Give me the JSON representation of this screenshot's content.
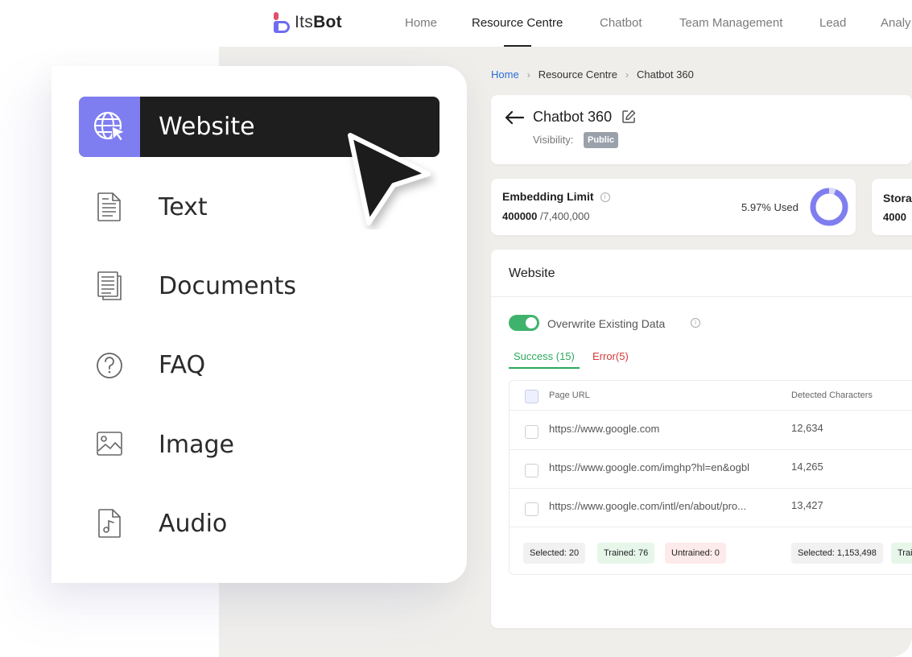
{
  "nav": {
    "brand_prefix": "Its",
    "brand_suffix": "Bot",
    "items": [
      "Home",
      "Resource Centre",
      "Chatbot",
      "Team Management",
      "Lead",
      "Analy"
    ],
    "active": "Resource Centre"
  },
  "breadcrumb": [
    "Home",
    "Resource Centre",
    "Chatbot 360"
  ],
  "bot": {
    "title": "Chatbot 360",
    "visibility_label": "Visibility:",
    "visibility": "Public"
  },
  "embedding": {
    "title": "Embedding Limit",
    "used": "400000",
    "total": "/7,400,000",
    "used_pct_label": "5.97% Used",
    "used_fraction": 0.0597
  },
  "storage": {
    "title": "Stora",
    "value": "4000"
  },
  "website": {
    "title": "Website",
    "overwrite_label": "Overwrite Existing Data",
    "overwrite_on": true,
    "tab_success": "Success (15)",
    "tab_error": "Error(5)",
    "columns": [
      "Page URL",
      "Detected Characters"
    ],
    "rows": [
      {
        "url": "https://www.google.com",
        "chars": "12,634"
      },
      {
        "url": "https://www.google.com/imghp?hl=en&ogbl",
        "chars": "14,265"
      },
      {
        "url": "https://www.google.com/intl/en/about/pro...",
        "chars": "13,427"
      }
    ],
    "footer": {
      "selected": "Selected: 20",
      "trained": "Trained: 76",
      "untrained": "Untrained: 0",
      "selected_chars": "Selected: 1,153,498",
      "trained_cut": "Trai"
    }
  },
  "source_menu": [
    {
      "label": "Website",
      "icon": "globe-cursor-icon",
      "active": true
    },
    {
      "label": "Text",
      "icon": "text-document-icon",
      "active": false
    },
    {
      "label": "Documents",
      "icon": "documents-icon",
      "active": false
    },
    {
      "label": "FAQ",
      "icon": "question-icon",
      "active": false
    },
    {
      "label": "Image",
      "icon": "image-icon",
      "active": false
    },
    {
      "label": "Audio",
      "icon": "audio-file-icon",
      "active": false
    }
  ],
  "colors": {
    "accent": "#7f7ef0",
    "success": "#2ea85e",
    "error": "#d63838",
    "dark": "#1e1e1e"
  }
}
